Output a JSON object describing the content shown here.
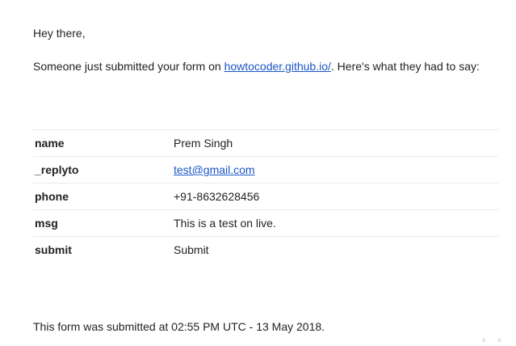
{
  "email": {
    "greeting": "Hey there,",
    "intro_prefix": "Someone just submitted your form on ",
    "intro_link": "howtocoder.github.io/",
    "intro_suffix": ". Here's what they had to say:",
    "fields": [
      {
        "key": "name",
        "value": "Prem Singh",
        "is_link": false
      },
      {
        "key": "_replyto",
        "value": "test@gmail.com",
        "is_link": true
      },
      {
        "key": "phone",
        "value": "+91-8632628456",
        "is_link": false
      },
      {
        "key": "msg",
        "value": "This is a test on live.",
        "is_link": false
      },
      {
        "key": "submit",
        "value": "Submit",
        "is_link": false
      }
    ],
    "footer": "This form was submitted at 02:55 PM UTC - 13 May 2018."
  },
  "colors": {
    "link": "#1a56c8",
    "text": "#222222",
    "row_border": "#ececec"
  }
}
